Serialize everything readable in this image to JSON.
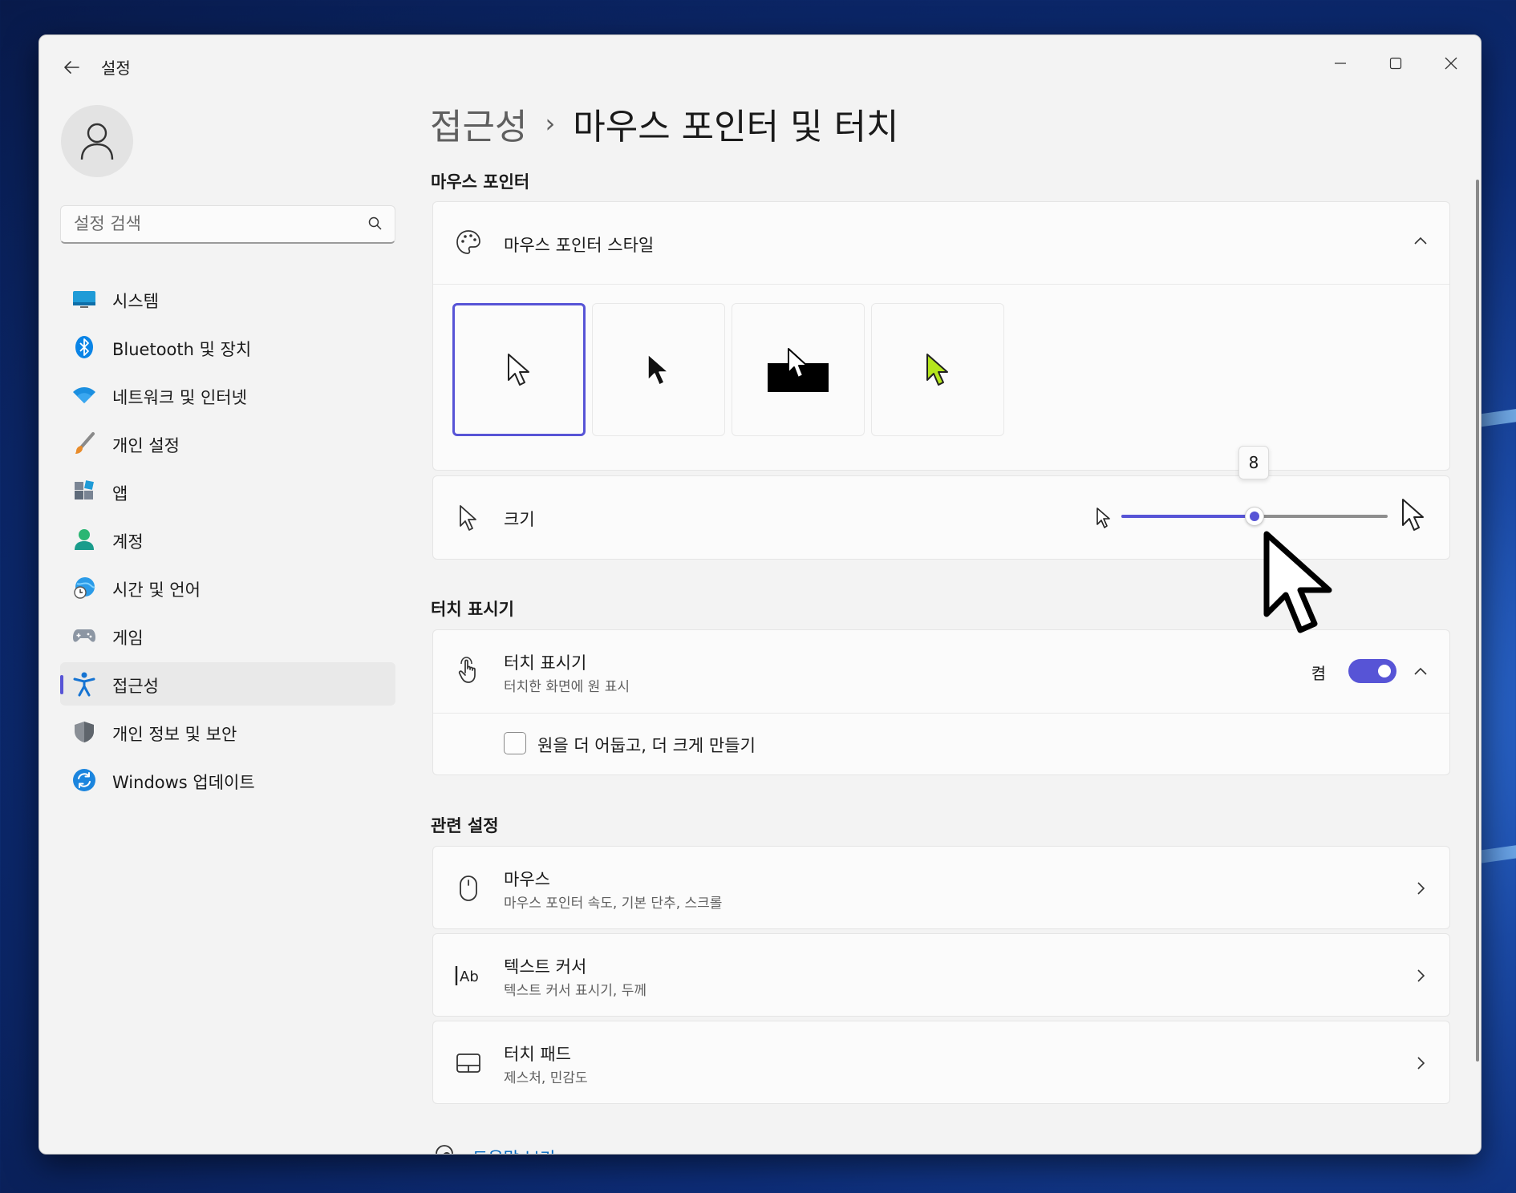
{
  "window": {
    "title": "설정"
  },
  "sidebar": {
    "search_placeholder": "설정 검색",
    "items": [
      {
        "label": "시스템",
        "icon": "system-icon"
      },
      {
        "label": "Bluetooth 및 장치",
        "icon": "bluetooth-icon"
      },
      {
        "label": "네트워크 및 인터넷",
        "icon": "wifi-icon"
      },
      {
        "label": "개인 설정",
        "icon": "brush-icon"
      },
      {
        "label": "앱",
        "icon": "apps-icon"
      },
      {
        "label": "계정",
        "icon": "account-icon"
      },
      {
        "label": "시간 및 언어",
        "icon": "globe-clock-icon"
      },
      {
        "label": "게임",
        "icon": "gamepad-icon"
      },
      {
        "label": "접근성",
        "icon": "accessibility-icon",
        "active": true
      },
      {
        "label": "개인 정보 및 보안",
        "icon": "shield-icon"
      },
      {
        "label": "Windows 업데이트",
        "icon": "update-icon"
      }
    ]
  },
  "breadcrumb": {
    "parent": "접근성",
    "separator": "›",
    "current": "마우스 포인터 및 터치"
  },
  "mouse_pointer": {
    "section_title": "마우스 포인터",
    "style": {
      "title": "마우스 포인터 스타일",
      "options": [
        "white",
        "black",
        "inverted",
        "custom"
      ],
      "selected_index": 0,
      "custom_color": "#b5e61d"
    },
    "size": {
      "title": "크기",
      "value": 8,
      "value_label": "8",
      "min": 1,
      "max": 15
    }
  },
  "touch_indicator": {
    "section_title": "터치 표시기",
    "title": "터치 표시기",
    "subtitle": "터치한 화면에 원 표시",
    "toggle_label": "켬",
    "toggle_on": true,
    "checkbox_label": "원을 더 어둡고, 더 크게 만들기",
    "checkbox_checked": false
  },
  "related": {
    "section_title": "관련 설정",
    "items": [
      {
        "title": "마우스",
        "subtitle": "마우스 포인터 속도, 기본 단추, 스크롤",
        "icon": "mouse-icon"
      },
      {
        "title": "텍스트 커서",
        "subtitle": "텍스트 커서 표시기, 두께",
        "icon": "text-cursor-icon"
      },
      {
        "title": "터치 패드",
        "subtitle": "제스처, 민감도",
        "icon": "touchpad-icon"
      }
    ]
  },
  "help": {
    "label": "도움말 보기"
  },
  "colors": {
    "accent": "#5754d6",
    "link": "#0067c0"
  }
}
